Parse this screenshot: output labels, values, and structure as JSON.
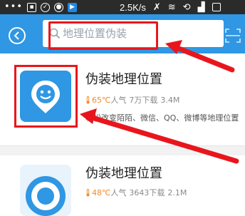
{
  "status_bar": {
    "dots": "•••",
    "net_speed": "2.5K/s"
  },
  "header": {
    "back_icon": "chevron-left-icon",
    "search_placeholder": "地理位置伪装",
    "scan_icon": "scan-icon",
    "background": "#2f97e3"
  },
  "results": [
    {
      "name": "伪装地理位置",
      "temperature": "65℃",
      "popularity": "人气",
      "downloads": "7万下载",
      "size": "3.4M",
      "description": "轻松改变陌陌、微信、QQ、微博等地理位置"
    },
    {
      "name": "伪装地理位置",
      "temperature": "48℃",
      "popularity": "人气",
      "downloads": "3643下载",
      "size": "2.1M",
      "description": ""
    }
  ],
  "colors": {
    "accent": "#2f97e3",
    "highlight": "#e8161c",
    "temperature": "#ef8b2c"
  }
}
